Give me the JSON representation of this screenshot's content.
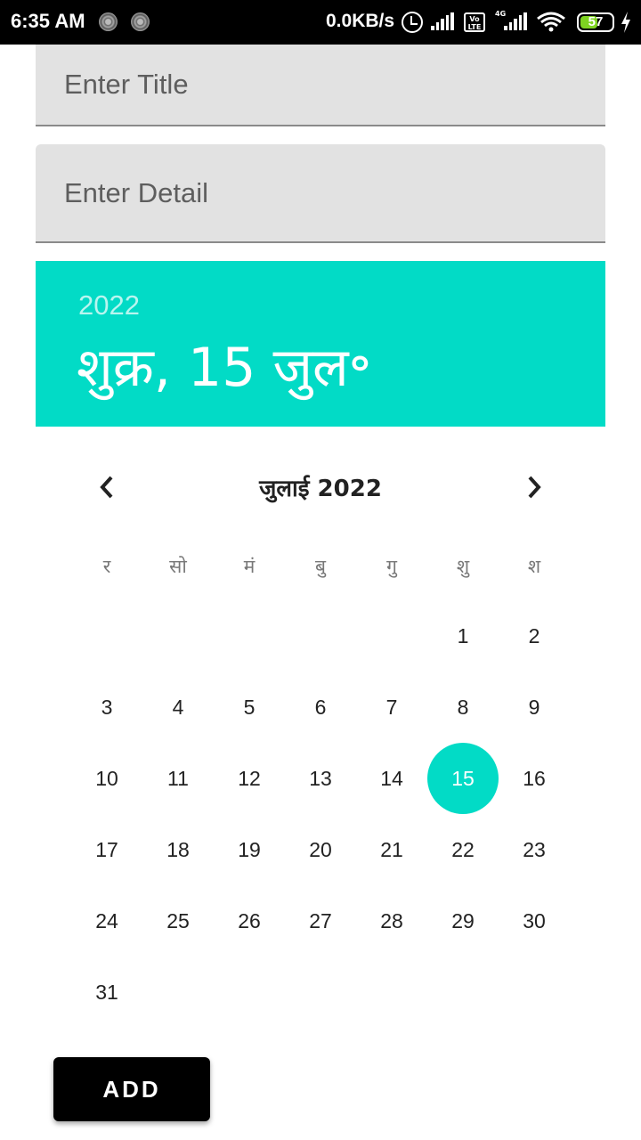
{
  "status_bar": {
    "time": "6:35 AM",
    "network_speed": "0.0KB/s",
    "volte_label_top": "Vo",
    "volte_label_bottom": "LTE",
    "network_type": "4G",
    "battery_level": "57",
    "battery_fraction": 0.57
  },
  "form": {
    "title_placeholder": "Enter Title",
    "detail_placeholder": "Enter Detail"
  },
  "date_picker": {
    "accent_color": "#02dbc6",
    "header_year": "2022",
    "header_date": "शुक्र, 15 जुल॰",
    "month_label": "जुलाई 2022",
    "weekdays": [
      "र",
      "सो",
      "मं",
      "बु",
      "गु",
      "शु",
      "श"
    ],
    "leading_blank_days": 5,
    "days_in_month": 31,
    "selected_day": 15
  },
  "actions": {
    "add_label": "ADD"
  }
}
